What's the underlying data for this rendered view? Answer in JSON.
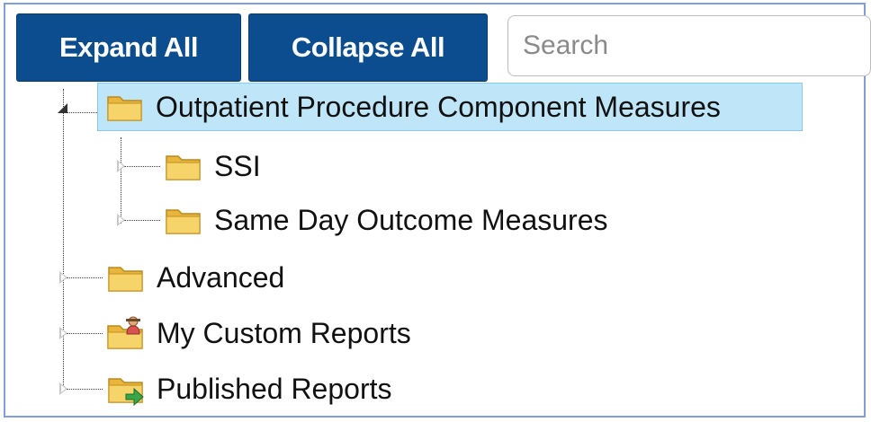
{
  "toolbar": {
    "expand_all_label": "Expand All",
    "collapse_all_label": "Collapse All",
    "search_placeholder": "Search",
    "search_value": ""
  },
  "colors": {
    "button_bg": "#0b4d8f",
    "selected_bg": "#bfe6f8",
    "folder": "#f3c74e"
  },
  "tree": {
    "root": {
      "label": "Outpatient Procedure Component Measures",
      "icon": "folder-open-icon",
      "state": "expanded",
      "selected": true,
      "children": [
        {
          "label": "SSI",
          "icon": "folder-icon",
          "state": "collapsed"
        },
        {
          "label": "Same Day Outcome Measures",
          "icon": "folder-icon",
          "state": "collapsed"
        }
      ]
    },
    "siblings": [
      {
        "label": "Advanced",
        "icon": "folder-icon",
        "state": "collapsed"
      },
      {
        "label": "My Custom Reports",
        "icon": "user-folder-icon",
        "state": "collapsed"
      },
      {
        "label": "Published Reports",
        "icon": "published-folder-icon",
        "state": "collapsed"
      }
    ]
  }
}
